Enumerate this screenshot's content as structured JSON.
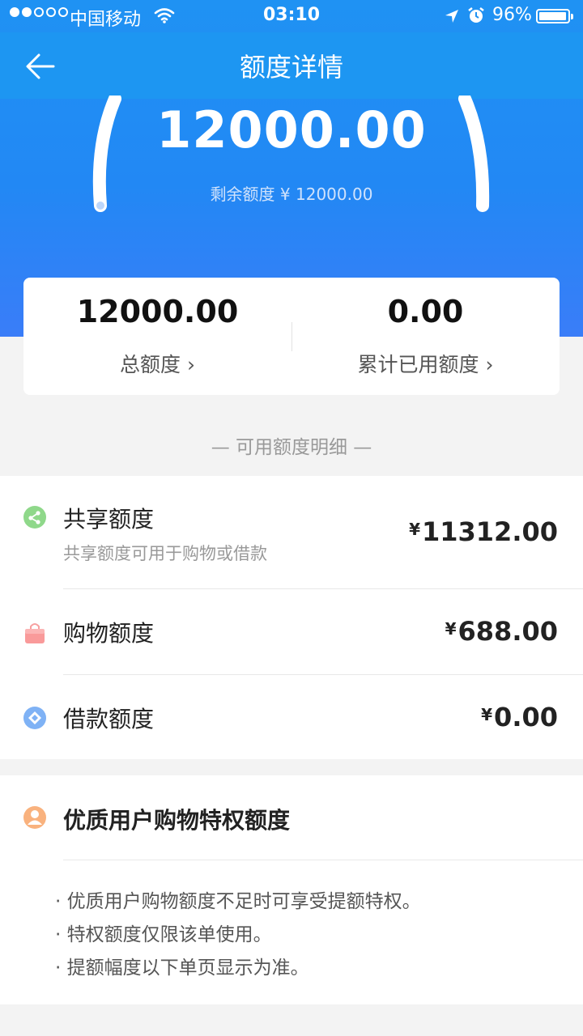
{
  "status_bar": {
    "carrier": "中国移动",
    "time": "03:10",
    "battery_percent": "96%"
  },
  "nav": {
    "title": "额度详情"
  },
  "hero": {
    "amount": "12000.00",
    "remaining": "剩余额度 ¥ 12000.00"
  },
  "summary": {
    "total_value": "12000.00",
    "total_label": "总额度 ›",
    "used_value": "0.00",
    "used_label": "累计已用额度 ›"
  },
  "section_label": "— 可用额度明细 —",
  "details": [
    {
      "name": "共享额度",
      "desc": "共享额度可用于购物或借款",
      "currency": "¥",
      "amount": "11312.00",
      "icon": "share-icon"
    },
    {
      "name": "购物额度",
      "desc": "",
      "currency": "¥",
      "amount": "688.00",
      "icon": "shopping-bag-icon"
    },
    {
      "name": "借款额度",
      "desc": "",
      "currency": "¥",
      "amount": "0.00",
      "icon": "loan-icon"
    }
  ],
  "privilege": {
    "title": "优质用户购物特权额度",
    "icon": "user-icon",
    "notes": [
      "优质用户购物额度不足时可享受提额特权。",
      "特权额度仅限该单使用。",
      "提额幅度以下单页显示为准。"
    ]
  },
  "colors": {
    "header_blue": "#1d96f2",
    "text_dark": "#222222",
    "muted": "#999999"
  }
}
